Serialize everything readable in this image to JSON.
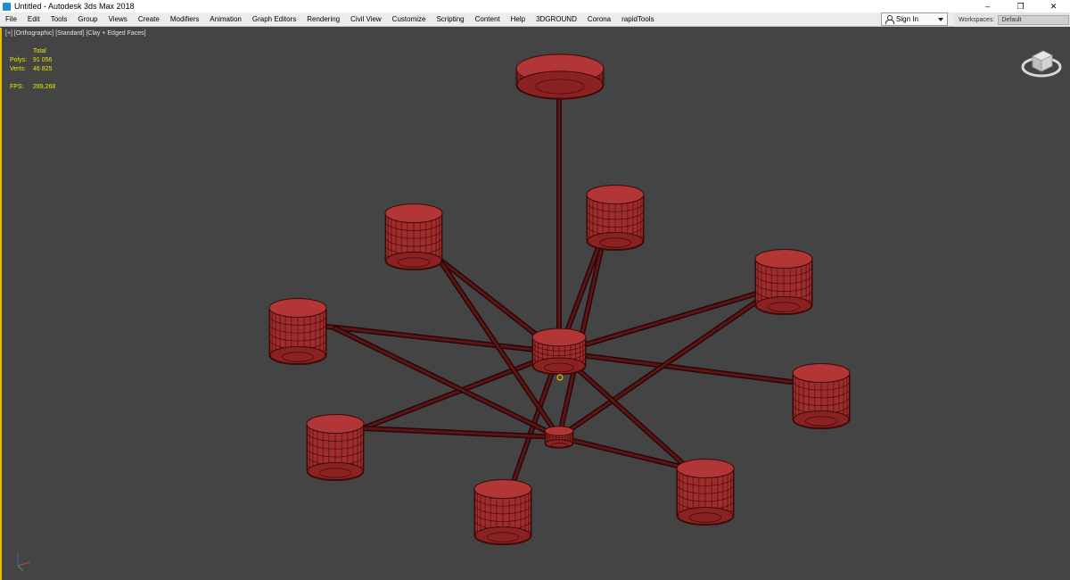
{
  "window": {
    "title": "Untitled - Autodesk 3ds Max 2018",
    "minimize": "–",
    "restore": "❐",
    "close": "✕"
  },
  "menu": [
    "File",
    "Edit",
    "Tools",
    "Group",
    "Views",
    "Create",
    "Modifiers",
    "Animation",
    "Graph Editors",
    "Rendering",
    "Civil View",
    "Customize",
    "Scripting",
    "Content",
    "Help",
    "3DGROUND",
    "Corona",
    "rapidTools"
  ],
  "signin": {
    "label": "Sign In"
  },
  "workspaces": {
    "label": "Workspaces:",
    "value": "Default"
  },
  "viewport": {
    "label": "[+] [Orthographic] [Standard] [Clay + Edged Faces]",
    "stats": {
      "header": "Total",
      "polys_label": "Polys:",
      "polys_value": "91 056",
      "verts_label": "Verts:",
      "verts_value": "46 825",
      "fps_label": "FPS:",
      "fps_value": "289,268"
    }
  },
  "colors": {
    "viewport_bg": "#444444",
    "shade_color": "#a02c2c",
    "wire_color": "#3a0a0a",
    "stat_text": "#e8e800",
    "active_border": "#e8c000"
  }
}
